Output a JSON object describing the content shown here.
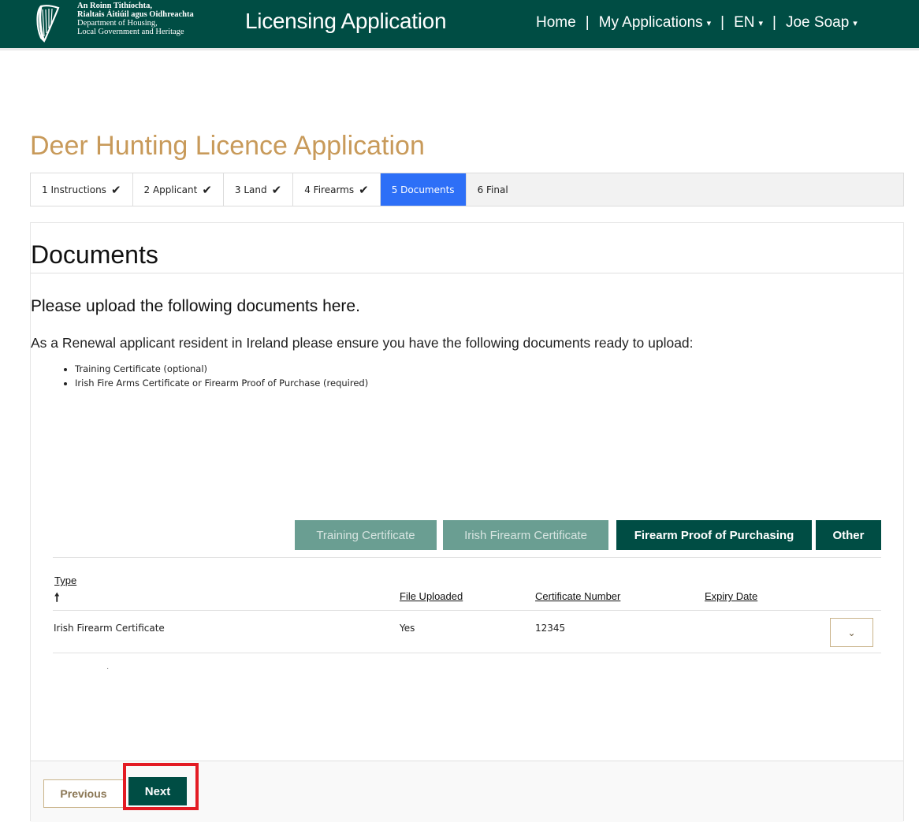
{
  "header": {
    "dept_line1": "An Roinn Tithíochta,",
    "dept_line2": "Rialtais Áitiúil agus Oidhreachta",
    "dept_line3": "Department of Housing,",
    "dept_line4": "Local Government and Heritage",
    "logo_icon": "harp-icon",
    "app_title": "Licensing Application",
    "nav": {
      "home": "Home",
      "my_applications": "My Applications",
      "language": "EN",
      "user": "Joe Soap",
      "separator": "|",
      "caret": "▾"
    }
  },
  "page_title": "Deer Hunting Licence Application",
  "steps": [
    {
      "label": "1 Instructions",
      "done": "✔"
    },
    {
      "label": "2 Applicant",
      "done": "✔"
    },
    {
      "label": "3 Land",
      "done": "✔"
    },
    {
      "label": "4 Firearms",
      "done": "✔"
    },
    {
      "label": "5 Documents",
      "done": ""
    },
    {
      "label": "6 Final",
      "done": ""
    }
  ],
  "panel": {
    "title": "Documents",
    "intro": "Please upload the following documents here.",
    "renewal_text": "As a Renewal applicant resident in Ireland please ensure you have the following documents ready to upload:",
    "documents": [
      "Training Certificate (optional)",
      "Irish Fire Arms Certificate or Firearm Proof of Purchase (required)"
    ]
  },
  "upload_buttons": {
    "training": "Training Certificate",
    "irish_firearm": "Irish Firearm Certificate",
    "proof": "Firearm Proof of Purchasing",
    "other": "Other"
  },
  "table": {
    "headers": {
      "type": "Type",
      "sort_arrow": "🠕",
      "file_uploaded": "File Uploaded",
      "certificate_number": "Certificate Number",
      "expiry_date": "Expiry Date"
    },
    "rows": [
      {
        "type": "Irish Firearm Certificate",
        "file_uploaded": "Yes",
        "certificate_number": "12345",
        "expiry_date": ""
      }
    ],
    "trailing_dot": "·",
    "expand_icon": "⌄"
  },
  "footer": {
    "previous": "Previous",
    "next": "Next"
  },
  "colors": {
    "brand_green": "#004d44",
    "accent_gold": "#c89a5a",
    "active_step": "#2d6ff7",
    "highlight_red": "#e31b23"
  }
}
